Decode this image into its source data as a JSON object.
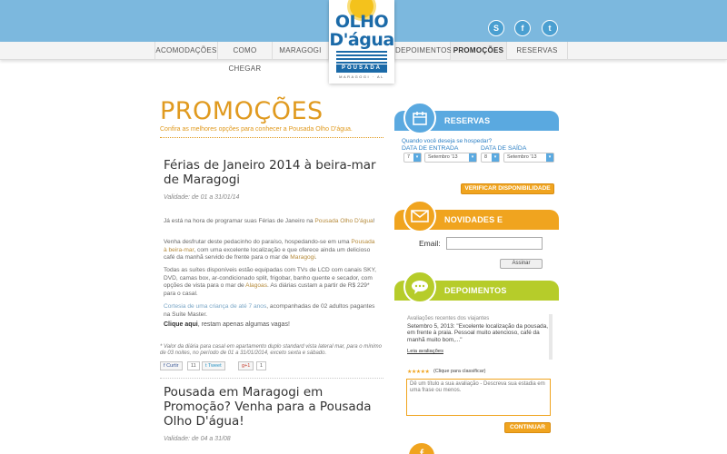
{
  "brand": {
    "logo_line1": "OLHO",
    "logo_line2": "D'água",
    "logo_sub": "POUSADA",
    "logo_city": "MARAGOGI · AL"
  },
  "social": {
    "skype_glyph": "S",
    "facebook_glyph": "f",
    "twitter_glyph": "t"
  },
  "nav": {
    "items": [
      "ACOMODAÇÕES",
      "COMO CHEGAR",
      "MARAGOGI",
      "DEPOIMENTOS",
      "PROMOÇÕES",
      "RESERVAS"
    ],
    "active": "PROMOÇÕES"
  },
  "main": {
    "title": "PROMOÇÕES",
    "subtitle": "Confira as melhores opções para conhecer a Pousada Olho D'água.",
    "post1": {
      "title": "Férias de Janeiro 2014 à beira-mar de Maragogi",
      "validade": "Validade: de 01 a 31/01/14",
      "p1_a": "Já está na hora de programar suas Férias de Janeiro na ",
      "p1_hl": "Pousada Olho D'água",
      "p1_b": "!",
      "p2_a": "Venha desfrutar deste pedacinho do paraíso, hospedando-se em uma ",
      "p2_hl": "Pousada à beira-mar",
      "p2_b": ", com uma excelente localização e que oferece ainda um delicioso café da manhã servido de frente para o mar de ",
      "p2_hl2": "Maragogi",
      "p2_c": ".",
      "p3_a": "Todas as suítes disponíveis estão equipadas com TVs de LCD com canais SKY, DVD, camas box, ar-condicionado split, frigobar, banho quente e secador, com opções de vista para o mar de ",
      "p3_hl": "Alagoas",
      "p3_b": ". As diárias custam a partir de R$ 229* para o casal.",
      "p4_hl": "Cortesia de uma criança de até 7 anos",
      "p4_b": ", acompanhadas de 02 adultos pagantes na Suíte Master.",
      "cta_bold": "Clique aqui",
      "cta_rest": ", restam apenas algumas vagas!",
      "footnote": "* Valor da diária para casal em apartamento duplo standard vista lateral mar, para o mínimo de 03 noites, no período de 01 a 31/01/2014, exceto sexta e sábado.",
      "share": {
        "facebook_label": "Curtir",
        "facebook_count": "11",
        "tweet_label": "Tweet",
        "gplus_label": "+1",
        "gplus_count": "1"
      }
    },
    "post2": {
      "title": "Pousada em Maragogi em Promoção? Venha para a Pousada Olho D'água!",
      "validade": "Validade: de 04 a 31/08"
    }
  },
  "sidebar": {
    "reservas": {
      "header": "RESERVAS",
      "question": "Quando você deseja se hospedar?",
      "checkin_label": "DATA DE ENTRADA",
      "checkout_label": "DATA DE SAÍDA",
      "checkin_day": "7",
      "checkin_month": "Setembro '13",
      "checkout_day": "8",
      "checkout_month": "Setembro '13",
      "button": "VERIFICAR DISPONIBILIDADE"
    },
    "novidades": {
      "header": "NOVIDADES E PROMOÇÕES",
      "email_label": "Email:",
      "email_value": "",
      "subscribe": "Assinar"
    },
    "depoimentos": {
      "header": "DEPOIMENTOS",
      "recent_label": "Avaliações recentes dos viajantes",
      "review": "Setembro 5, 2013: \"Excelente localização da pousada, em frente à praia. Pessoal muito atencioso, café da manhã muito bom,...\"",
      "read_link": "Leia avaliações",
      "stars": "★★★★★",
      "stars_label": "(Clique para classificar)",
      "textarea_placeholder": "Dê um título a sua avaliação - Descreva sua estadia em uma frase ou menos.",
      "continue": "CONTINUAR"
    }
  },
  "colors": {
    "topbar": "#7cb8de",
    "title_orange": "#e09a1f",
    "widget_blue": "#5aa9e0",
    "widget_orange": "#f0a41f",
    "widget_green": "#b6cc2a",
    "logo_blue": "#1b6aa8"
  },
  "icons": {
    "reservas": "calendar-icon",
    "novidades": "envelope-icon",
    "depoimentos": "speech-bubble-icon"
  }
}
